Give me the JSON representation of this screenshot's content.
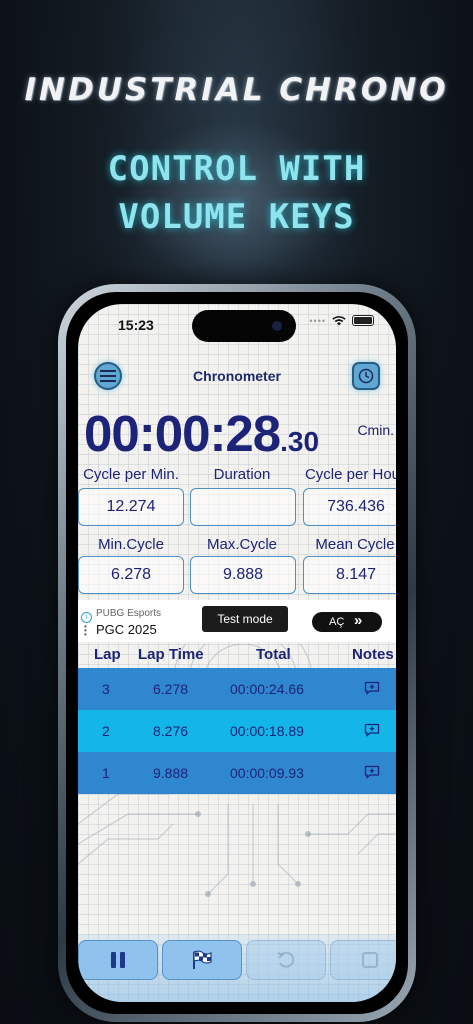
{
  "promo": {
    "app_name": "INDUSTRIAL CHRONO",
    "tagline_line1": "CONTROL WITH",
    "tagline_line2": "VOLUME KEYS"
  },
  "status_bar": {
    "time": "15:23"
  },
  "nav": {
    "menu_icon": "hamburger-menu-icon",
    "title": "Chronometer",
    "history_icon": "clock-icon"
  },
  "timer": {
    "main": "00:00:28",
    "fraction": ".30",
    "unit": "Cmin."
  },
  "stats": {
    "cycle_per_min": {
      "label": "Cycle per Min.",
      "value": "12.274"
    },
    "duration": {
      "label": "Duration",
      "value": ""
    },
    "cycle_per_hour": {
      "label": "Cycle per Hour",
      "value": "736.436"
    },
    "min_cycle": {
      "label": "Min.Cycle",
      "value": "6.278"
    },
    "max_cycle": {
      "label": "Max.Cycle",
      "value": "9.888"
    },
    "mean_cycle": {
      "label": "Mean Cycle",
      "value": "8.147"
    }
  },
  "ad": {
    "sub": "PUBG Esports",
    "main": "PGC 2025",
    "test_mode": "Test mode",
    "cta": "AÇ",
    "cta_arrows": "»"
  },
  "table": {
    "headers": [
      "Lap",
      "Lap Time",
      "Total",
      "Notes"
    ],
    "rows": [
      {
        "lap": "3",
        "lap_time": "6.278",
        "total": "00:00:24.66",
        "color": "#2f87d0"
      },
      {
        "lap": "2",
        "lap_time": "8.276",
        "total": "00:00:18.89",
        "color": "#14b5e8"
      },
      {
        "lap": "1",
        "lap_time": "9.888",
        "total": "00:00:09.93",
        "color": "#2f87d0"
      }
    ],
    "note_icon": "add-note-icon"
  },
  "controls": {
    "pause_icon": "pause-icon",
    "lap_icon": "checkered-flag-icon",
    "reset_icon": "undo-icon",
    "save_icon": "save-icon"
  },
  "colors": {
    "accent": "#1d2377",
    "row_dark": "#2f87d0",
    "row_light": "#14b5e8",
    "tagline": "#8fe4ee"
  }
}
